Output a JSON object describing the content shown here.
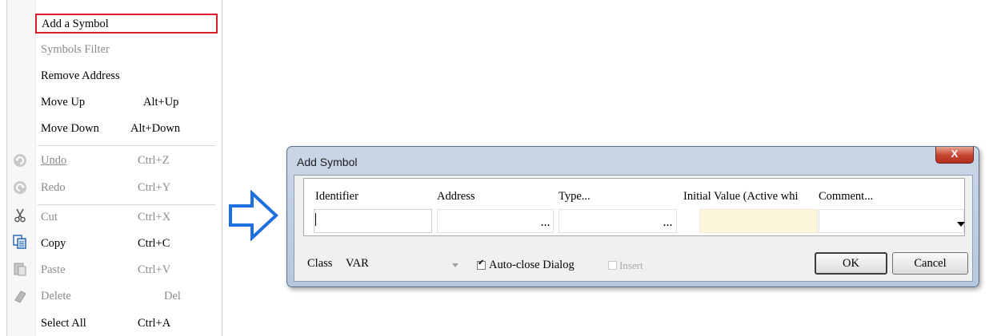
{
  "context_menu": {
    "items": [
      {
        "label": "Add a Symbol",
        "shortcut": "",
        "state": "highlighted"
      },
      {
        "label": "Symbols Filter",
        "shortcut": "",
        "state": "disabled"
      },
      {
        "label": "Remove Address",
        "shortcut": "",
        "state": "enabled"
      },
      {
        "label": "Move Up",
        "shortcut": "Alt+Up",
        "state": "enabled"
      },
      {
        "label": "Move Down",
        "shortcut": "Alt+Down",
        "state": "enabled"
      },
      {
        "label": "Undo",
        "shortcut": "Ctrl+Z",
        "state": "disabled",
        "icon": "undo-icon"
      },
      {
        "label": "Redo",
        "shortcut": "Ctrl+Y",
        "state": "disabled",
        "icon": "redo-icon"
      },
      {
        "label": "Cut",
        "shortcut": "Ctrl+X",
        "state": "disabled",
        "icon": "scissors-icon"
      },
      {
        "label": "Copy",
        "shortcut": "Ctrl+C",
        "state": "enabled",
        "icon": "copy-icon"
      },
      {
        "label": "Paste",
        "shortcut": "Ctrl+V",
        "state": "disabled",
        "icon": "paste-icon"
      },
      {
        "label": "Delete",
        "shortcut": "Del",
        "state": "disabled",
        "icon": "eraser-icon"
      },
      {
        "label": "Select All",
        "shortcut": "Ctrl+A",
        "state": "enabled"
      }
    ],
    "highlight_color": "#d9202a"
  },
  "arrow": {
    "color": "#1e6fe0",
    "icon": "right-arrow-icon"
  },
  "dialog": {
    "title": "Add Symbol",
    "close_label": "X",
    "columns": {
      "identifier": "Identifier",
      "address": "Address",
      "type": "Type...",
      "initial_value": "Initial Value (Active whi",
      "comment": "Comment..."
    },
    "ellipsis": "...",
    "class_label": "Class",
    "class_value": "VAR",
    "auto_close_label": "Auto-close Dialog",
    "auto_close_checked": true,
    "insert_label": "Insert",
    "insert_checked": false,
    "ok_label": "OK",
    "cancel_label": "Cancel",
    "initial_value_field_color": "#fdf6dc"
  }
}
